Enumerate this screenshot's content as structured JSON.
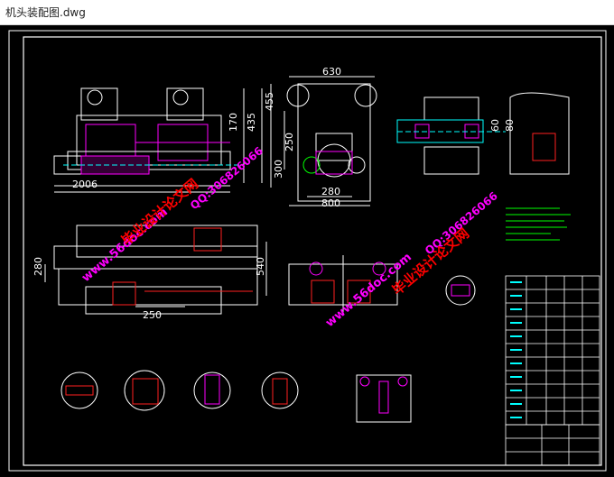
{
  "window": {
    "title": "机头装配图.dwg"
  },
  "drawing": {
    "dimensions": {
      "d630": "630",
      "d455": "455",
      "d435": "435",
      "d170": "170",
      "d250": "250",
      "d300": "300",
      "d2006": "2006",
      "d280a": "280",
      "d800": "800",
      "d280b": "280",
      "d540": "540",
      "d250b": "250",
      "d60": "60",
      "d80": "80"
    },
    "watermarks": {
      "site_1": "www.56doc.com",
      "site_2": "www.56doc.com",
      "qq_1": "QQ:306826066",
      "qq_2": "QQ:306826066",
      "brand_1": "毕业设计论文网",
      "brand_2": "毕业设计论文网"
    }
  },
  "colors": {
    "background": "#000000",
    "frame": "#ffffff",
    "part_magenta": "#ff00ff",
    "part_cyan": "#00ffff",
    "part_red": "#ff2020",
    "part_yellow": "#ffff00",
    "part_green": "#00ff00",
    "watermark_red": "#ff0000",
    "watermark_magenta": "#ff00ff"
  }
}
